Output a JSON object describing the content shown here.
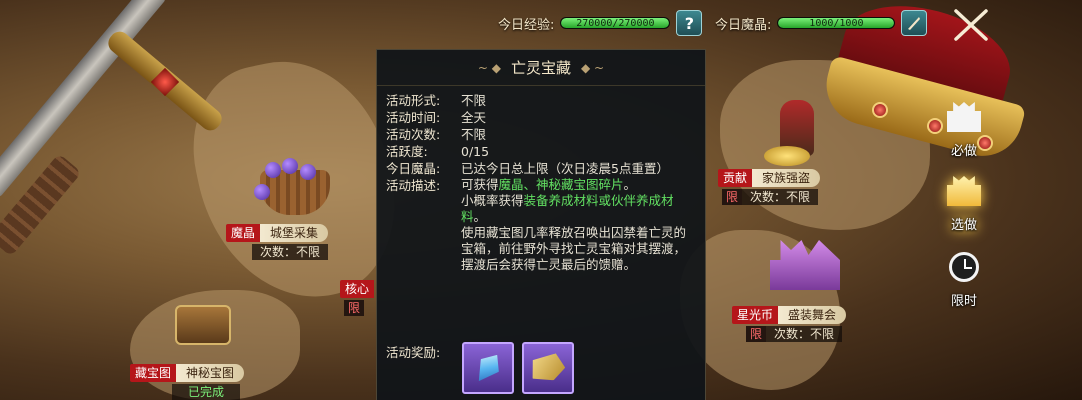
{
  "hud": {
    "exp_label": "今日经验:",
    "exp_value": "270000/270000",
    "exp_fill": 1.0,
    "help_icon": "?",
    "mojing_label": "今日魔晶:",
    "mojing_value": "1000/1000",
    "mojing_fill": 1.0,
    "close_icon": "close-icon"
  },
  "panel": {
    "title": "亡灵宝藏",
    "title_left_ornament": "~ ◆",
    "title_right_ornament": "◆ ~",
    "rows": [
      {
        "key": "活动形式:",
        "value": "不限"
      },
      {
        "key": "活动时间:",
        "value": "全天"
      },
      {
        "key": "活动次数:",
        "value": "不限"
      },
      {
        "key": "活跃度:",
        "value": "0/15"
      },
      {
        "key": "今日魔晶:",
        "value": "已达今日总上限（次日凌晨5点重置）"
      }
    ],
    "desc_key": "活动描述:",
    "desc": {
      "line1_a": "可获得",
      "line1_b": "魔晶、神秘藏宝图碎片",
      "line1_c": "。",
      "line2_a": "小概率获得",
      "line2_b": "装备养成材料或伙伴养成材料",
      "line2_c": "。",
      "line3": "使用藏宝图几率释放召唤出囚禁着亡灵的宝箱，前往野外寻找亡灵宝箱对其摆渡，摆渡后会获得亡灵最后的馈赠。"
    },
    "reward_key": "活动奖励:",
    "rewards": [
      "crystal-icon",
      "treasure-map-fragment-icon"
    ]
  },
  "nodes": {
    "castle_collect": {
      "cat": "魔晶",
      "name": "城堡采集",
      "count": "次数：不限"
    },
    "core": {
      "cat": "核心",
      "lim": "限"
    },
    "treasure_map": {
      "cat": "藏宝图",
      "name": "神秘宝图",
      "status": "已完成"
    },
    "family_bandit": {
      "cat": "贡献",
      "name": "家族强盗",
      "lim": "限",
      "count": "次数：不限"
    },
    "masquerade": {
      "cat": "星光币",
      "name": "盛装舞会",
      "lim": "限",
      "count": "次数：不限"
    }
  },
  "side_menu": [
    {
      "label": "必做",
      "icon": "castle-icon"
    },
    {
      "label": "选做",
      "icon": "castle-icon"
    },
    {
      "label": "限时",
      "icon": "alarm-clock-icon"
    }
  ],
  "colors": {
    "bar_green": "#27a52a",
    "tag_red": "#b5161a",
    "text_green": "#62e062"
  }
}
